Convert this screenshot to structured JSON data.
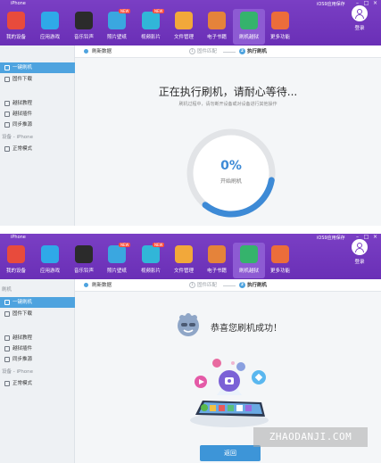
{
  "titlebar": {
    "device": "iPhone",
    "right_label": "iOS9应用保存"
  },
  "nav": [
    {
      "label": "我的设备",
      "color": "#e84b3c"
    },
    {
      "label": "应用游戏",
      "color": "#2fa9e8"
    },
    {
      "label": "音乐铃声",
      "color": "#d23b3b"
    },
    {
      "label": "照片壁纸",
      "color": "#3aa7e0",
      "badge": "NEW"
    },
    {
      "label": "视频影片",
      "color": "#31b6d8",
      "badge": "NEW"
    },
    {
      "label": "文件管理",
      "color": "#f2a83a"
    },
    {
      "label": "电子书籍",
      "color": "#e5833a"
    },
    {
      "label": "刷机越狱",
      "color": "#35b36c"
    },
    {
      "label": "更多功能",
      "color": "#ec6d3a"
    }
  ],
  "login_label": "登录",
  "sidebar": {
    "section_flash": "刷机",
    "items_flash": [
      "一键刷机",
      "固件下载"
    ],
    "items_jb": [
      "越狱教程",
      "越狱插件",
      "同步推源"
    ],
    "section_device": "设备 - iPhone",
    "item_normal": "正常模式"
  },
  "steps": {
    "refresh": "刷新数据",
    "step1": "固件匹配",
    "step2": "执行刷机",
    "n1": "1",
    "n2": "2"
  },
  "flashing": {
    "title": "正在执行刷机，请耐心等待...",
    "subtitle": "刷机过程中，请勿断开设备或对设备进行其他操作",
    "progress_text": "0%",
    "progress_value": 0,
    "progress_label": "开始刷机"
  },
  "success": {
    "title": "恭喜您刷机成功！",
    "return_button": "返回"
  },
  "watermark": "ZHAODANJI.COM",
  "colors": {
    "accent": "#4ea3df",
    "topbar": "#7a3fc4",
    "progress": "#3d8ad6"
  }
}
